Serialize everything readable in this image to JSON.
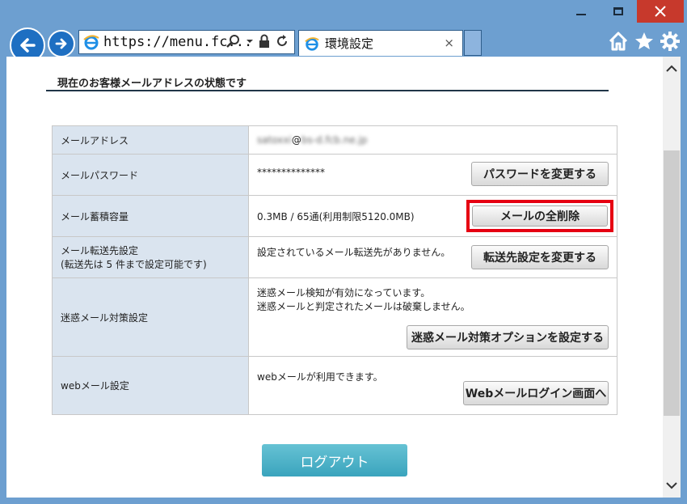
{
  "browser": {
    "address": "https://menu.fc...",
    "tab_title": "環境設定",
    "tab_close": "×"
  },
  "page": {
    "section_title": "現在のお客様メールアドレスの状態です",
    "rows": [
      {
        "label": "メールアドレス",
        "value_prefix": "satoxxi",
        "value_at": "@",
        "value_domain": "bs-d.fcb.ne.jp"
      },
      {
        "label": "メールパスワード",
        "value": "**************",
        "button": "パスワードを変更する"
      },
      {
        "label": "メール蓄積容量",
        "value": "0.3MB / 65通(利用制限5120.0MB)",
        "button": "メールの全削除"
      },
      {
        "label_line1": "メール転送先設定",
        "label_line2": "(転送先は 5 件まで設定可能です)",
        "value": "設定されているメール転送先がありません。",
        "button": "転送先設定を変更する"
      },
      {
        "label": "迷惑メール対策設定",
        "value_line1": "迷惑メール検知が有効になっています。",
        "value_line2": "迷惑メールと判定されたメールは破棄しません。",
        "button": "迷惑メール対策オプションを設定する"
      },
      {
        "label": "webメール設定",
        "value": "webメールが利用できます。",
        "button": "Webメールログイン画面へ"
      }
    ],
    "logout": "ログアウト"
  },
  "colors": {
    "accent": "#e60012",
    "logout": "#3aa4bd",
    "label_bg": "#dae4ef"
  }
}
